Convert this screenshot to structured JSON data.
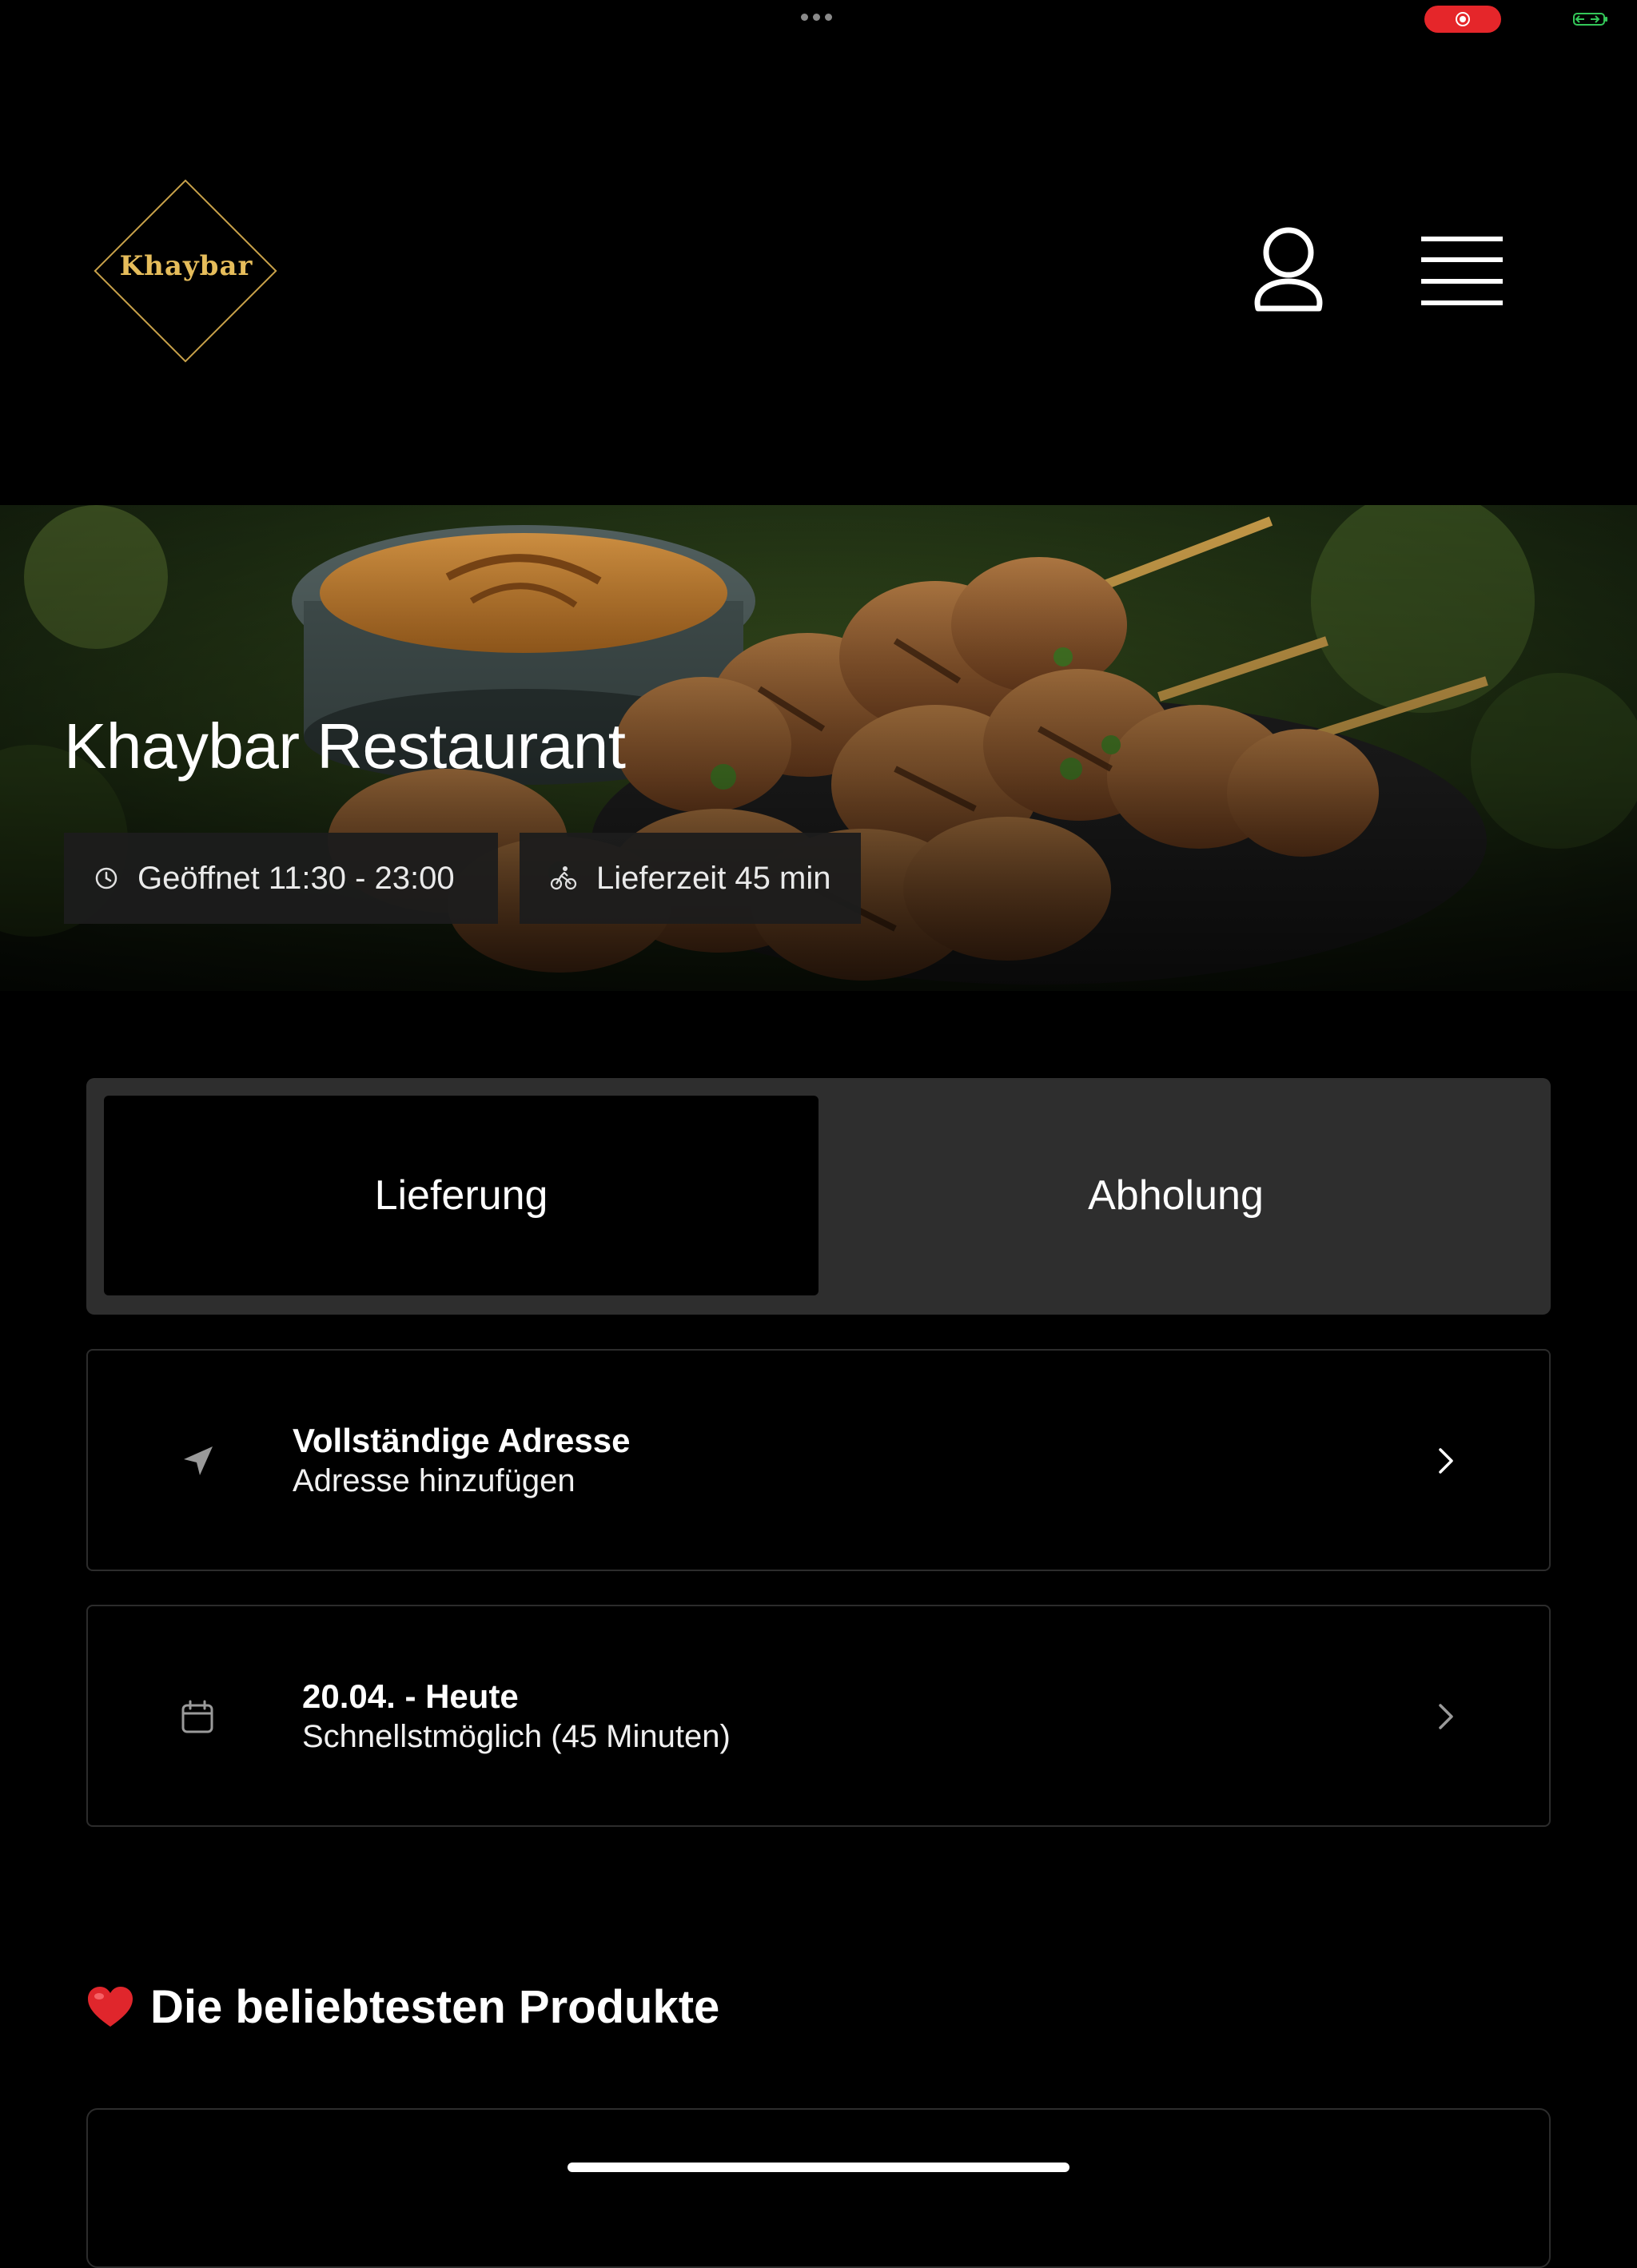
{
  "status_bar": {
    "recording_icon": "screen-record-icon",
    "battery_icon": "battery-charging-icon",
    "battery_color": "#34c759",
    "recording_color": "#e5262a"
  },
  "header": {
    "logo_text": "Khaybar",
    "logo_color": "#e6bd5b",
    "profile_icon": "user-icon",
    "menu_icon": "hamburger-menu-icon"
  },
  "hero": {
    "title": "Khaybar Restaurant",
    "opening_hours": "Geöffnet 11:30 - 23:00",
    "delivery_time": "Lieferzeit 45 min",
    "opening_icon": "clock-icon",
    "delivery_icon": "bicycle-icon"
  },
  "order_mode": {
    "options": [
      {
        "label": "Lieferung",
        "selected": true
      },
      {
        "label": "Abholung",
        "selected": false
      }
    ]
  },
  "address_card": {
    "icon": "location-arrow-icon",
    "title": "Vollständige Adresse",
    "subtitle": "Adresse hinzufügen"
  },
  "date_card": {
    "icon": "calendar-icon",
    "title": "20.04. - Heute",
    "subtitle": "Schnellstmöglich (45 Minuten)"
  },
  "popular": {
    "emoji_icon": "red-heart-icon",
    "title": "Die beliebtesten Produkte"
  }
}
